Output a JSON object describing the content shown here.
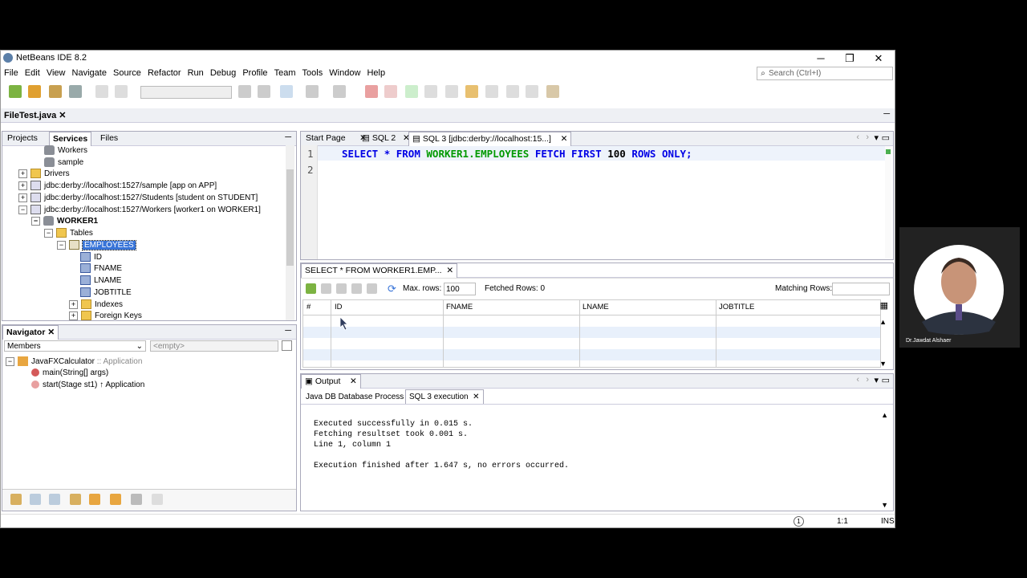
{
  "window": {
    "title": "NetBeans IDE 8.2"
  },
  "menu": [
    "File",
    "Edit",
    "View",
    "Navigate",
    "Source",
    "Refactor",
    "Run",
    "Debug",
    "Profile",
    "Team",
    "Tools",
    "Window",
    "Help"
  ],
  "search": {
    "placeholder": "Search (Ctrl+I)"
  },
  "file_tab": {
    "label": "FileTest.java"
  },
  "left_tabs": {
    "projects": "Projects",
    "services": "Services",
    "files": "Files"
  },
  "tree": [
    {
      "label": "Workers"
    },
    {
      "label": "sample"
    },
    {
      "label": "Drivers"
    },
    {
      "label": "jdbc:derby://localhost:1527/sample [app on APP]"
    },
    {
      "label": "jdbc:derby://localhost:1527/Students [student on STUDENT]"
    },
    {
      "label": "jdbc:derby://localhost:1527/Workers [worker1 on WORKER1]"
    },
    {
      "label": "WORKER1"
    },
    {
      "label": "Tables"
    },
    {
      "label": "EMPLOYEES"
    },
    {
      "label": "ID"
    },
    {
      "label": "FNAME"
    },
    {
      "label": "LNAME"
    },
    {
      "label": "JOBTITLE"
    },
    {
      "label": "Indexes"
    },
    {
      "label": "Foreign Keys"
    }
  ],
  "navigator": {
    "title": "Navigator",
    "members": "Members",
    "filter": "<empty>",
    "items": [
      {
        "label": "JavaFXCalculator",
        "suffix": " :: Application"
      },
      {
        "label": "main(String[] args)"
      },
      {
        "label": "start(Stage st1) ↑ Application"
      }
    ]
  },
  "editor_tabs": [
    "Start Page",
    "SQL 2",
    "SQL 3 [jdbc:derby://localhost:15...]"
  ],
  "editor": {
    "line_numbers": [
      "1",
      "2"
    ],
    "sql": {
      "k1": "SELECT",
      "star": "*",
      "k2": "FROM",
      "table": "WORKER1.EMPLOYEES",
      "k3": "FETCH",
      "k4": "FIRST",
      "num": "100",
      "k5": "ROWS",
      "k6": "ONLY;"
    }
  },
  "results": {
    "tab": "SELECT * FROM WORKER1.EMP...",
    "max_rows_label": "Max. rows:",
    "max_rows_value": "100",
    "fetched_label": "Fetched Rows: 0",
    "matching_label": "Matching Rows:",
    "columns": [
      "#",
      "ID",
      "FNAME",
      "LNAME",
      "JOBTITLE"
    ]
  },
  "output": {
    "title": "Output",
    "tabs": [
      "Java DB Database Process",
      "SQL 3 execution"
    ],
    "lines": [
      "Executed successfully in 0.015 s.",
      "Fetching resultset took 0.001 s.",
      "Line 1, column 1",
      "",
      "Execution finished after 1.647 s, no errors occurred."
    ]
  },
  "status": {
    "position": "1:1",
    "mode": "INS"
  },
  "presenter": {
    "name": "Dr.Jawdat Alshaer"
  },
  "colors": {
    "keyword": "#0000e6",
    "identifier": "#009900",
    "selection": "#3874d8"
  }
}
